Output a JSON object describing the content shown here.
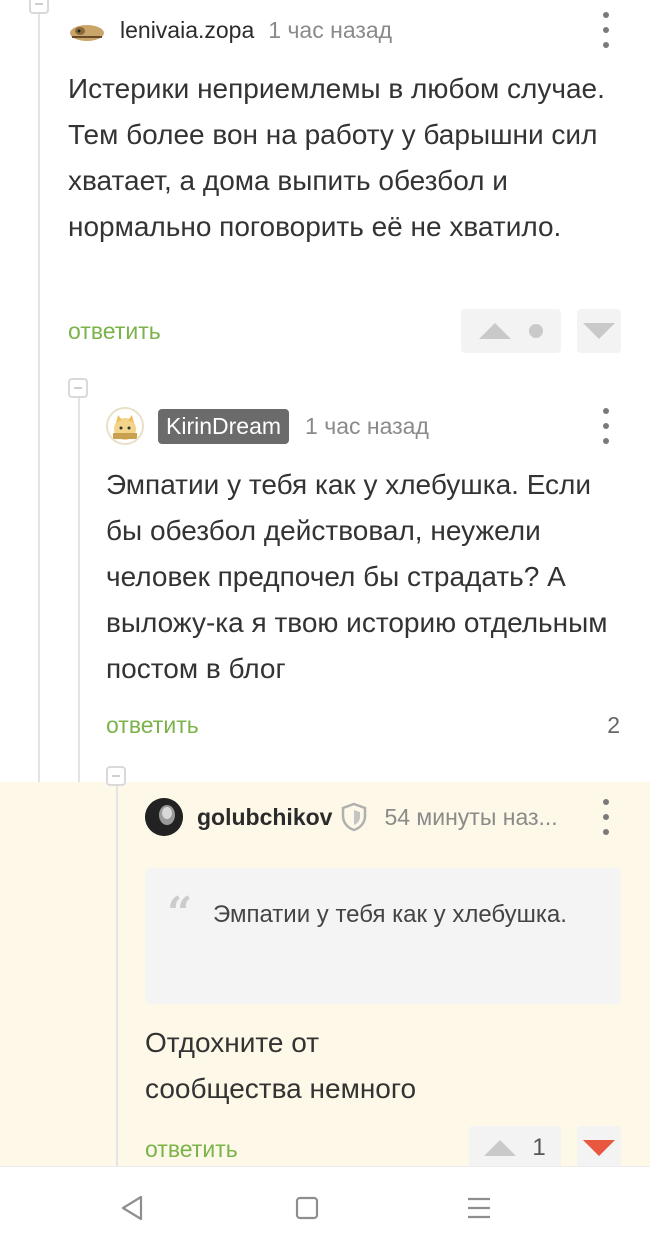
{
  "comments": [
    {
      "author": "lenivaia.zopa",
      "time": "1 час назад",
      "text": "Истерики неприемлемы в любом случае. Тем более вон на работу у барышни сил хватает, а дома выпить обезбол и нормально поговорить её не хватило.",
      "reply_label": "ответить"
    },
    {
      "author": "KirinDream",
      "time": "1 час назад",
      "text": "Эмпатии у тебя как у хлебушка. Если бы обезбол действовал, неужели человек предпочел бы страдать? А выложу-ка я твою историю отдельным постом в блог",
      "reply_label": "ответить",
      "replies_count": "2"
    },
    {
      "author": "golubchikov",
      "time": "54 минуты наз...",
      "quote": "Эмпатии у тебя как у хлебушка.",
      "text": "Отдохните от сообщества немного",
      "reply_label": "ответить",
      "rating": "1"
    }
  ],
  "colors": {
    "reply_green": "#7bb34a",
    "highlight_bg": "#fdf8e7",
    "downvote_active": "#e9573f"
  },
  "icons": {
    "nav_back": "back-triangle-icon",
    "nav_home": "home-square-icon",
    "nav_menu": "menu-lines-icon"
  }
}
